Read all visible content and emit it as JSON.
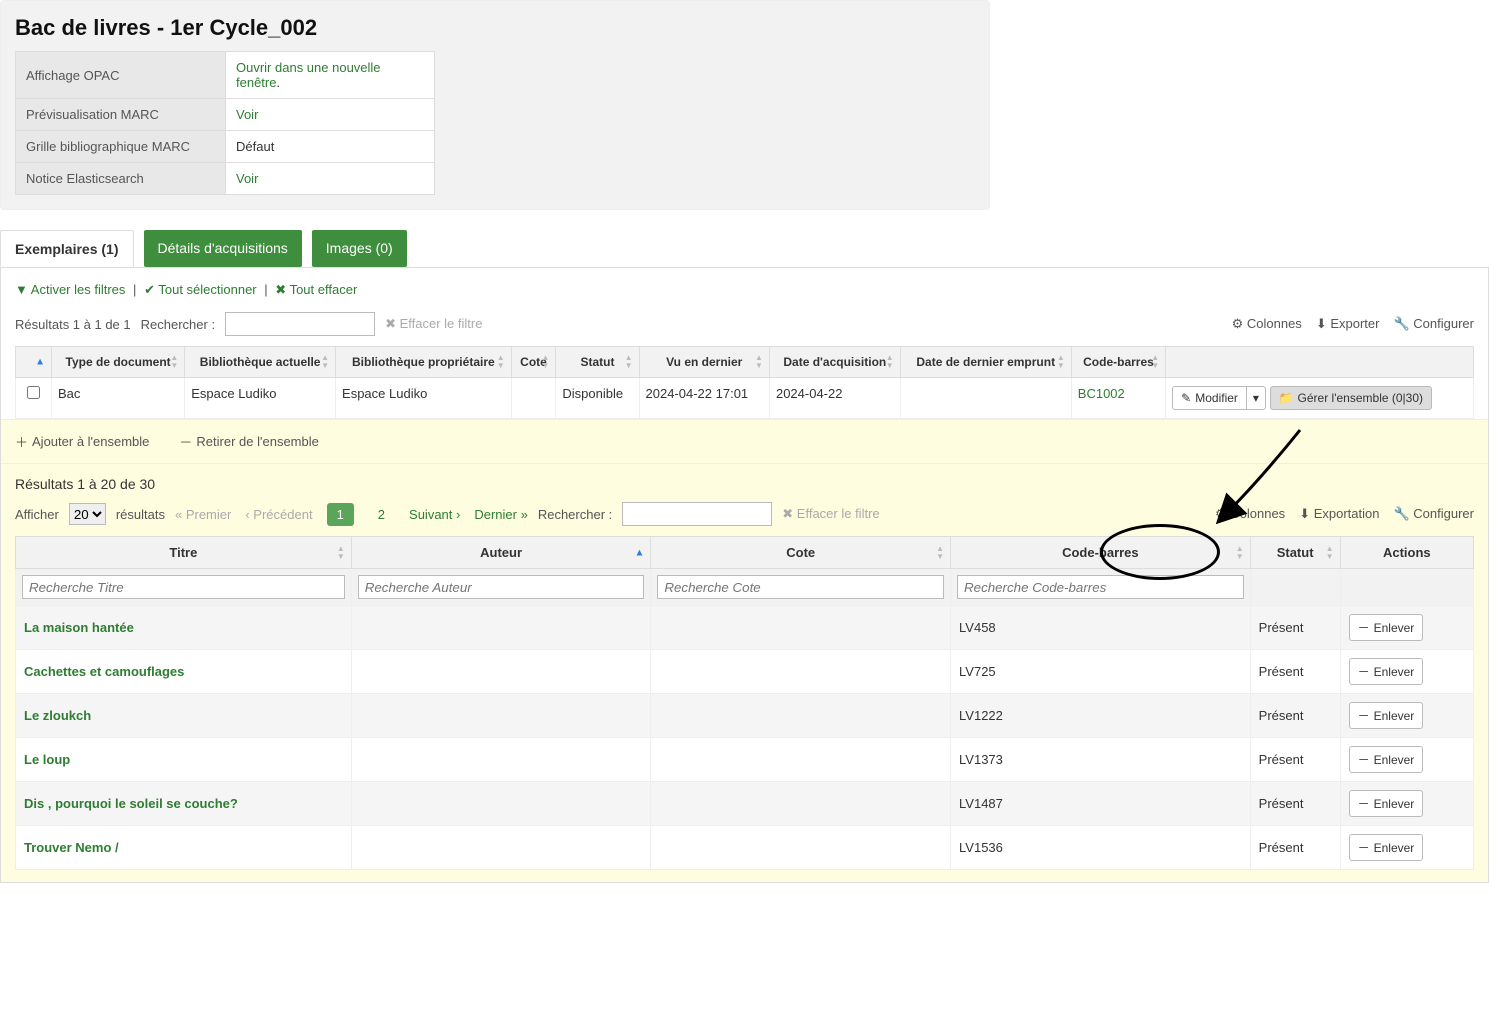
{
  "header": {
    "title": "Bac de livres - 1er Cycle_002",
    "meta": [
      {
        "label": "Affichage OPAC",
        "value": "Ouvrir dans une nouvelle fenêtre",
        "link": true,
        "suffix": "."
      },
      {
        "label": "Prévisualisation MARC",
        "value": "Voir",
        "link": true
      },
      {
        "label": "Grille bibliographique MARC",
        "value": "Défaut",
        "link": false
      },
      {
        "label": "Notice Elasticsearch",
        "value": "Voir",
        "link": true
      }
    ]
  },
  "tabs": {
    "items": [
      {
        "label": "Exemplaires (1)",
        "active": true
      },
      {
        "label": "Détails d'acquisitions",
        "active": false
      },
      {
        "label": "Images (0)",
        "active": false
      }
    ]
  },
  "filters": {
    "activate": "Activer les filtres",
    "select_all": "Tout sélectionner",
    "clear_all": "Tout effacer"
  },
  "items_toolbar": {
    "results": "Résultats 1 à 1 de 1",
    "search_label": "Rechercher :",
    "clear_filter": "Effacer le filtre",
    "columns": "Colonnes",
    "export": "Exporter",
    "configure": "Configurer"
  },
  "items_table": {
    "cols": [
      "",
      "Type de document",
      "Bibliothèque actuelle",
      "Bibliothèque propriétaire",
      "Cote",
      "Statut",
      "Vu en dernier",
      "Date d'acquisition",
      "Date de dernier emprunt",
      "Code-barres",
      ""
    ],
    "row": {
      "doctype": "Bac",
      "current_lib": "Espace Ludiko",
      "owner_lib": "Espace Ludiko",
      "cote": "",
      "status": "Disponible",
      "last_seen": "2024-04-22 17:01",
      "acq_date": "2024-04-22",
      "last_loan": "",
      "barcode": "BC1002",
      "edit": "Modifier",
      "bundle": "Gérer l'ensemble (0|30)"
    }
  },
  "bundle_actions": {
    "add": "Ajouter à l'ensemble",
    "remove": "Retirer de l'ensemble"
  },
  "bundle": {
    "results": "Résultats 1 à 20 de 30",
    "show": "Afficher",
    "per_page": "20",
    "results_suffix": "résultats",
    "first": "Premier",
    "prev": "Précédent",
    "page1": "1",
    "page2": "2",
    "next": "Suivant",
    "last": "Dernier",
    "search_label": "Rechercher :",
    "clear_filter": "Effacer le filtre",
    "columns": "Colonnes",
    "export": "Exportation",
    "configure": "Configurer",
    "cols": [
      "Titre",
      "Auteur",
      "Cote",
      "Code-barres",
      "Statut",
      "Actions"
    ],
    "filter_placeholders": [
      "Recherche Titre",
      "Recherche Auteur",
      "Recherche Cote",
      "Recherche Code-barres"
    ],
    "remove_label": "Enlever",
    "rows": [
      {
        "title": "La maison hantée",
        "author": "",
        "cote": "",
        "barcode": "LV458",
        "status": "Présent"
      },
      {
        "title": "Cachettes et camouflages",
        "author": "",
        "cote": "",
        "barcode": "LV725",
        "status": "Présent"
      },
      {
        "title": "Le zloukch",
        "author": "",
        "cote": "",
        "barcode": "LV1222",
        "status": "Présent"
      },
      {
        "title": "Le loup",
        "author": "",
        "cote": "",
        "barcode": "LV1373",
        "status": "Présent"
      },
      {
        "title": "Dis , pourquoi le soleil se couche?",
        "author": "",
        "cote": "",
        "barcode": "LV1487",
        "status": "Présent"
      },
      {
        "title": "Trouver Nemo /",
        "author": "",
        "cote": "",
        "barcode": "LV1536",
        "status": "Présent"
      }
    ]
  }
}
